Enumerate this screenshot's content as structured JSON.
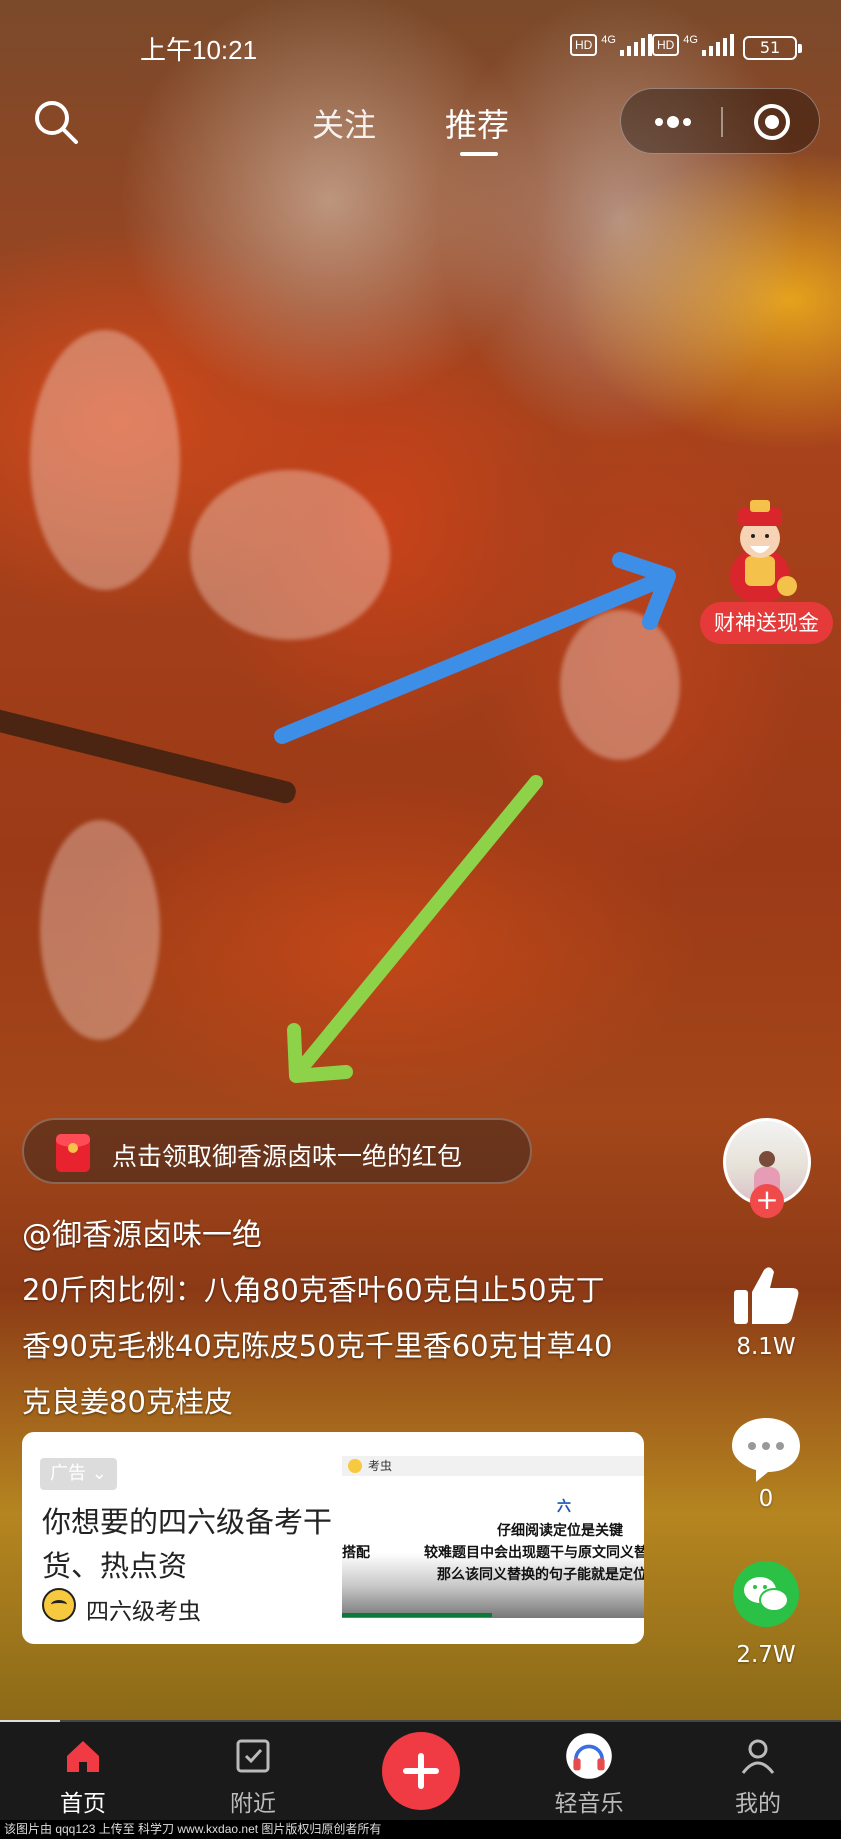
{
  "status_bar": {
    "time": "上午10:21",
    "hd_label": "HD",
    "network_label": "4G",
    "battery": "51"
  },
  "top_nav": {
    "tabs": [
      {
        "label": "关注",
        "active": false
      },
      {
        "label": "推荐",
        "active": true
      }
    ]
  },
  "promo": {
    "label": "财神送现金"
  },
  "red_packet": {
    "text": "点击领取御香源卤味一绝的红包"
  },
  "caption": {
    "author": "@御香源卤味一绝",
    "description": "20斤肉比例：八角80克香叶60克白止50克丁香90克毛桃40克陈皮50克千里香60克甘草40克良姜80克桂皮"
  },
  "ad": {
    "tag": "广告",
    "title": "你想要的四六级备考干货、热点资",
    "brand": "四六级考虫",
    "thumbnail": {
      "app_name": "考虫",
      "lines": [
        "六",
        "仔细阅读定位是关键",
        "较难题目中会出现题干与原文同义替",
        "那么该同义替换的句子能就是定位",
        "搭配"
      ]
    }
  },
  "right_rail": {
    "likes": "8.1W",
    "comments": "0",
    "shares": "2.7W"
  },
  "bottom_nav": {
    "items": [
      {
        "label": "首页",
        "icon": "home-icon",
        "active": true
      },
      {
        "label": "附近",
        "icon": "nearby-icon",
        "active": false
      },
      {
        "label": "轻音乐",
        "icon": "music-icon",
        "active": false
      },
      {
        "label": "我的",
        "icon": "profile-icon",
        "active": false
      }
    ]
  },
  "watermark": "该图片由 qqq123 上传至 科学刀 www.kxdao.net 图片版权归原创者所有",
  "colors": {
    "accent_red": "#f03b44",
    "wechat_green": "#2ac146",
    "arrow_blue": "#3d8ee6",
    "arrow_green": "#8ed24a"
  }
}
